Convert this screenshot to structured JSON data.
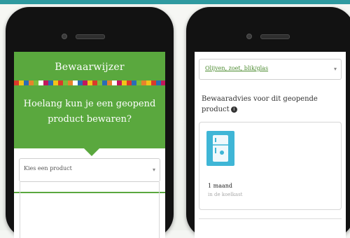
{
  "left_screen": {
    "title": "Bewaarwijzer",
    "question": "Hoelang kun je een geopend product bewaren?",
    "select_placeholder": "Kies een product",
    "stripe_colors": [
      "#d93a2b",
      "#f0c419",
      "#2a6db5",
      "#e7822c",
      "#7bbf3a",
      "#ffffff",
      "#c2185b",
      "#2a6db5",
      "#f0c419",
      "#d93a2b",
      "#7bbf3a",
      "#e7822c",
      "#ffffff",
      "#2a6db5",
      "#c2185b",
      "#f0c419",
      "#d93a2b",
      "#7bbf3a",
      "#2a6db5",
      "#e7822c",
      "#ffffff",
      "#c2185b",
      "#f0c419",
      "#d93a2b",
      "#2a6db5",
      "#7bbf3a",
      "#e7822c",
      "#f0c419",
      "#d93a2b",
      "#2a6db5",
      "#c2185b"
    ]
  },
  "right_screen": {
    "select_value": "Olijven, zoet, blik/glas",
    "advice_title": "Bewaaradvies voor dit geopende product",
    "card": {
      "icon": "fridge-icon",
      "duration": "1 maand",
      "location": "in de koelkast"
    }
  },
  "colors": {
    "brand_green": "#5aa83e",
    "fridge_blue": "#3fb6d6"
  }
}
